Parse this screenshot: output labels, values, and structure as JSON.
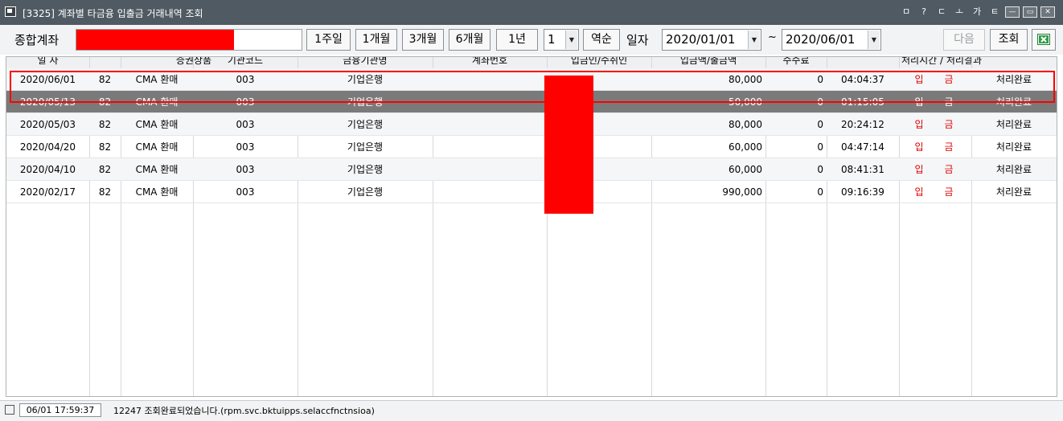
{
  "window": {
    "title": "[3325] 계좌별 타금융 입출금 거래내역 조회",
    "title_icons": [
      "?",
      "ㄷ",
      "ㅗ",
      "가",
      "ㅌ"
    ],
    "controls": [
      "—",
      "▭",
      "✕"
    ]
  },
  "toolbar": {
    "account_label": "종합계좌",
    "account_value": "",
    "period_buttons": [
      "1주일",
      "1개월",
      "3개월",
      "6개월",
      "1년"
    ],
    "count_value": "1",
    "order_label": "역순",
    "date_label": "일자",
    "date_from": "2020/01/01",
    "tilde": "~",
    "date_to": "2020/06/01",
    "next_label": "다음",
    "search_label": "조회",
    "excel_icon": "excel-icon"
  },
  "grid": {
    "headers": [
      "일 자",
      "증권상품",
      "기관코드",
      "금융기관명",
      "계좌번호",
      "입금인/수취인",
      "입금액/출금액",
      "수수료",
      "처리시간 / 처리결과"
    ],
    "rows": [
      {
        "date": "2020/06/01",
        "code": "82",
        "product": "CMA 환매",
        "inst_code": "003",
        "inst_name": "기업은행",
        "account": "",
        "amount": "80,000",
        "fee": "0",
        "time": "04:04:37",
        "t1": "입",
        "t2": "금",
        "result": "처리완료"
      },
      {
        "date": "2020/05/13",
        "code": "82",
        "product": "CMA 환매",
        "inst_code": "003",
        "inst_name": "기업은행",
        "account": "",
        "amount": "50,000",
        "fee": "0",
        "time": "01:15:05",
        "t1": "입",
        "t2": "금",
        "result": "처리완료"
      },
      {
        "date": "2020/05/03",
        "code": "82",
        "product": "CMA 환매",
        "inst_code": "003",
        "inst_name": "기업은행",
        "account": "",
        "amount": "80,000",
        "fee": "0",
        "time": "20:24:12",
        "t1": "입",
        "t2": "금",
        "result": "처리완료"
      },
      {
        "date": "2020/04/20",
        "code": "82",
        "product": "CMA 환매",
        "inst_code": "003",
        "inst_name": "기업은행",
        "account": "",
        "amount": "60,000",
        "fee": "0",
        "time": "04:47:14",
        "t1": "입",
        "t2": "금",
        "result": "처리완료"
      },
      {
        "date": "2020/04/10",
        "code": "82",
        "product": "CMA 환매",
        "inst_code": "003",
        "inst_name": "기업은행",
        "account": "",
        "amount": "60,000",
        "fee": "0",
        "time": "08:41:31",
        "t1": "입",
        "t2": "금",
        "result": "처리완료"
      },
      {
        "date": "2020/02/17",
        "code": "82",
        "product": "CMA 환매",
        "inst_code": "003",
        "inst_name": "기업은행",
        "account": "",
        "amount": "990,000",
        "fee": "0",
        "time": "09:16:39",
        "t1": "입",
        "t2": "금",
        "result": "처리완료"
      }
    ]
  },
  "status": {
    "time": "06/01 17:59:37",
    "message": "12247 조회완료되었습니다.(rpm.svc.bktuipps.selaccfnctnsioa)"
  },
  "colors": {
    "titlebar": "#505a62",
    "selected_row": "#7a7a7a",
    "redaction": "#ff0000",
    "deposit_text": "#e00000"
  }
}
